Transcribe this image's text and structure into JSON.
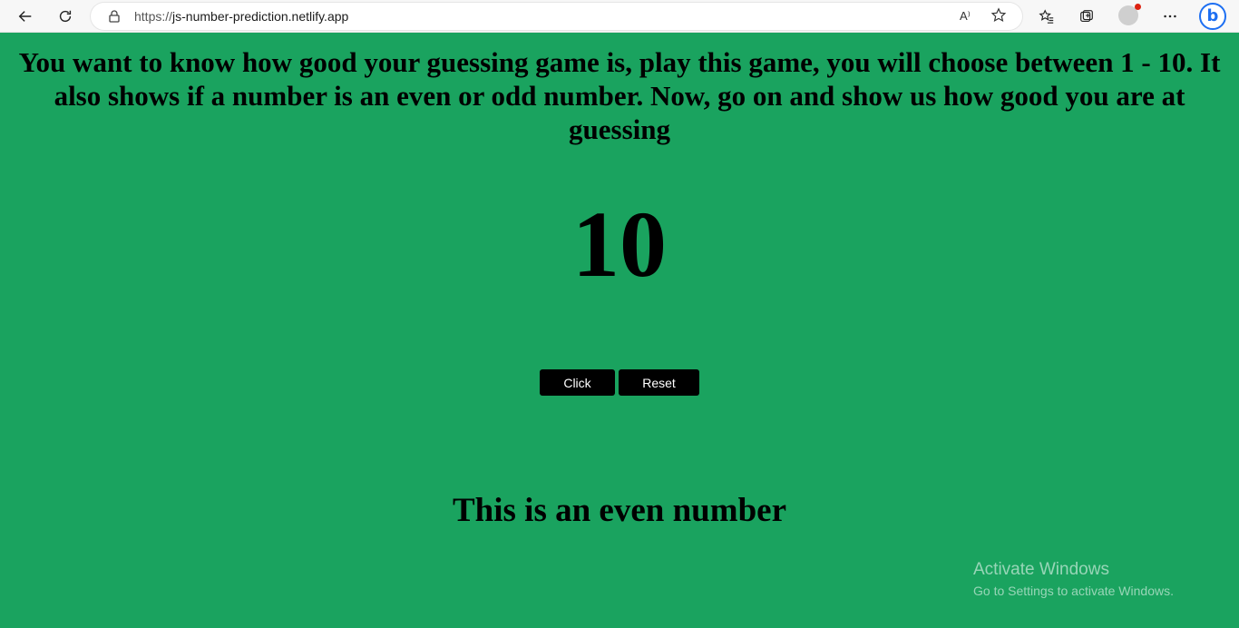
{
  "browser": {
    "url_prefix": "https://",
    "url_host": "js-number-prediction.netlify.app",
    "read_aloud_label": "A⁾"
  },
  "page": {
    "intro_text": "You want to know how good your guessing game is, play this game, you will choose between 1 - 10. It also shows if a number is an even or odd number. Now, go on and show us how good you are at guessing",
    "number": "10",
    "click_label": "Click",
    "reset_label": "Reset",
    "result_text": "This is an even number",
    "background_color": "#1aa35f"
  },
  "watermark": {
    "line1": "Activate Windows",
    "line2": "Go to Settings to activate Windows."
  }
}
